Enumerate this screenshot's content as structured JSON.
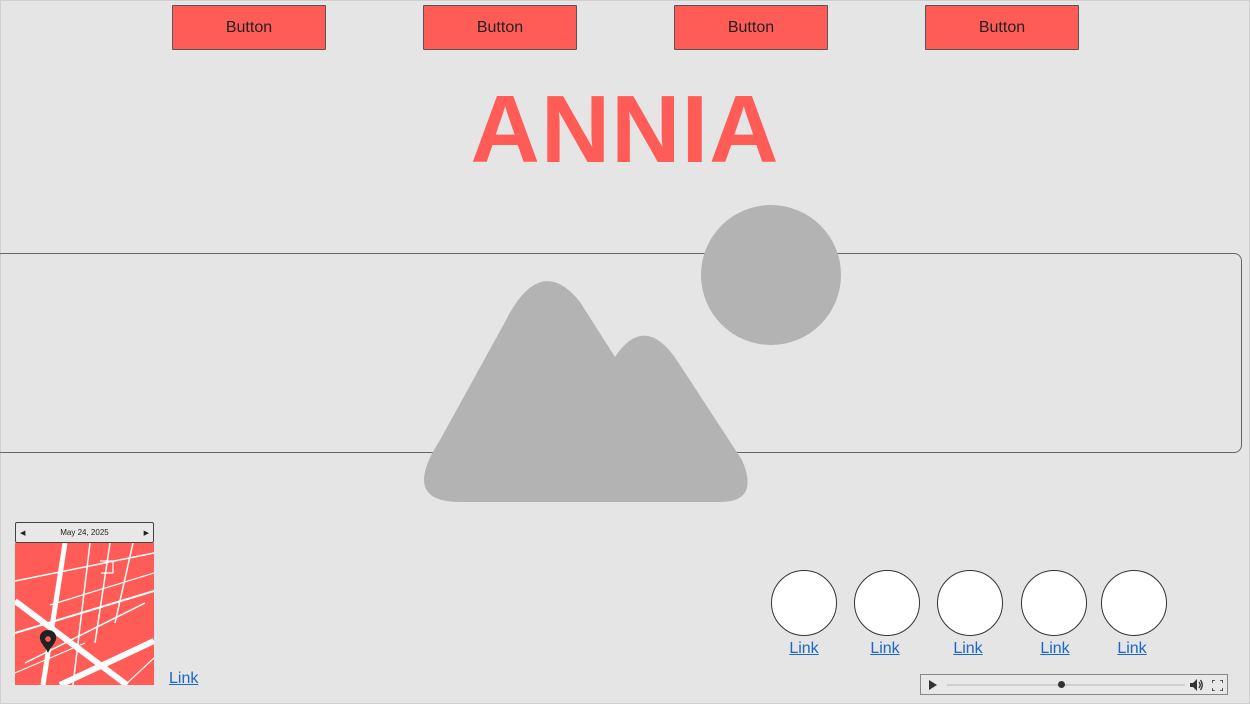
{
  "nav": {
    "buttons": [
      "Button",
      "Button",
      "Button",
      "Button"
    ]
  },
  "hero": {
    "title": "ANNIA",
    "image_icon": "image-placeholder-icon"
  },
  "calendar": {
    "date": "May 24, 2025",
    "prev_icon": "triangle-left-icon",
    "next_icon": "triangle-right-icon"
  },
  "map": {
    "pin_icon": "map-pin-icon"
  },
  "links": {
    "map_link": "Link",
    "circle_links": [
      "Link",
      "Link",
      "Link",
      "Link",
      "Link"
    ]
  },
  "player": {
    "play_icon": "play-icon",
    "volume_icon": "volume-icon",
    "fullscreen_icon": "fullscreen-icon",
    "progress": 0.48
  },
  "colors": {
    "accent": "#ff5c57",
    "background": "#e5e5e5",
    "link": "#1a66c9",
    "placeholder": "#b3b3b3"
  }
}
